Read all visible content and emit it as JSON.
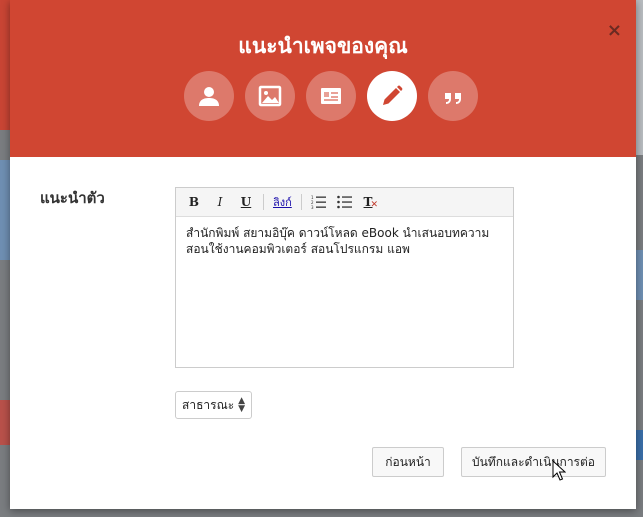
{
  "dialog": {
    "title": "แนะนำเพจของคุณ",
    "close_label": "×"
  },
  "steps": [
    {
      "icon": "user-icon",
      "active": false
    },
    {
      "icon": "image-icon",
      "active": false
    },
    {
      "icon": "id-card-icon",
      "active": false
    },
    {
      "icon": "pencil-icon",
      "active": true
    },
    {
      "icon": "quote-icon",
      "active": false
    }
  ],
  "form": {
    "label": "แนะนำตัว",
    "editor_text": "สำนักพิมพ์ สยามอิบุ๊ค ดาวน์โหลด eBook นำเสนอบทความ สอนใช้งานคอมพิวเตอร์ สอนโปรแกรม แอพ"
  },
  "toolbar": {
    "bold": "B",
    "italic": "I",
    "underline": "U",
    "link": "ลิงก์",
    "clear": "T"
  },
  "privacy": {
    "selected": "สาธารณะ"
  },
  "buttons": {
    "back": "ก่อนหน้า",
    "save": "บันทึกและดำเนินการต่อ"
  },
  "colors": {
    "header": "#d04632",
    "accent": "#ffffff"
  }
}
